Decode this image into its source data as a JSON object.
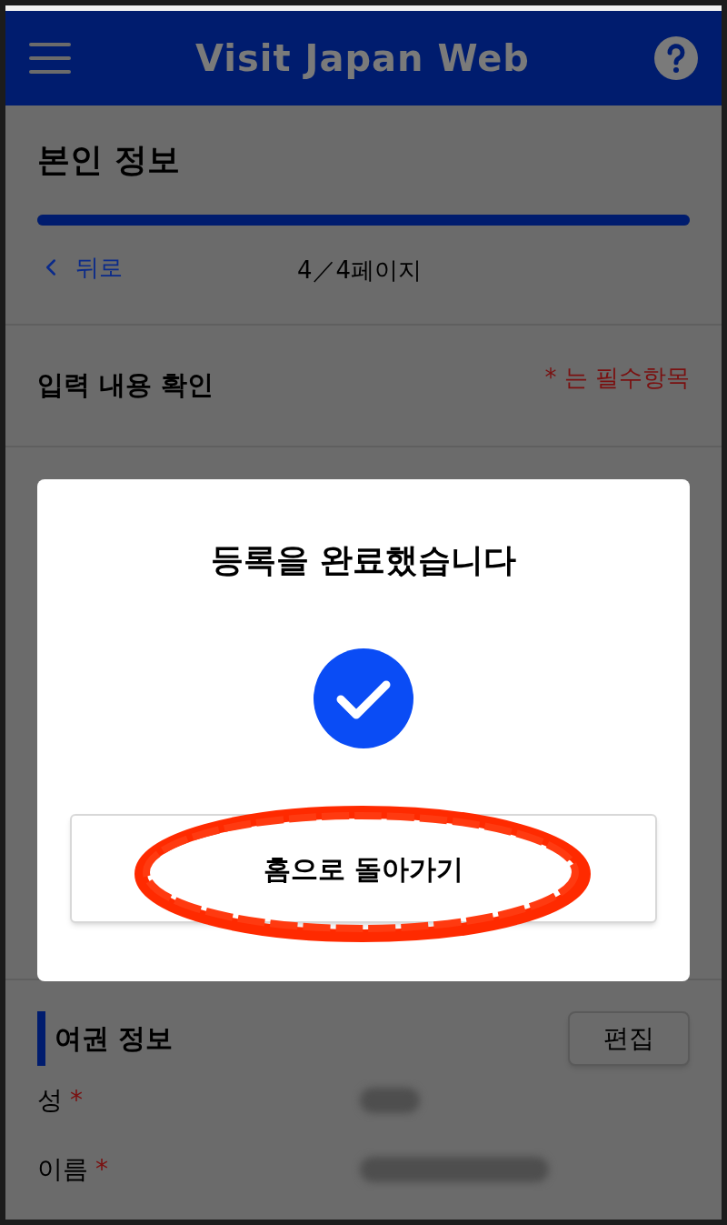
{
  "header": {
    "title": "Visit Japan Web"
  },
  "page": {
    "title": "본인 정보",
    "progress": {
      "level": 1
    },
    "back": "뒤로",
    "page_indicator": "4／4페이지"
  },
  "section": {
    "title": "입력 내용 확인",
    "required_note": "* 는 필수항목"
  },
  "passport": {
    "title": "여권 정보",
    "edit_button": "편집",
    "fields": [
      {
        "label": "성",
        "required_mark": "*"
      },
      {
        "label": "이름",
        "required_mark": "*"
      }
    ]
  },
  "modal": {
    "title": "등록을 완료했습니다",
    "button": "홈으로 돌아가기"
  }
}
